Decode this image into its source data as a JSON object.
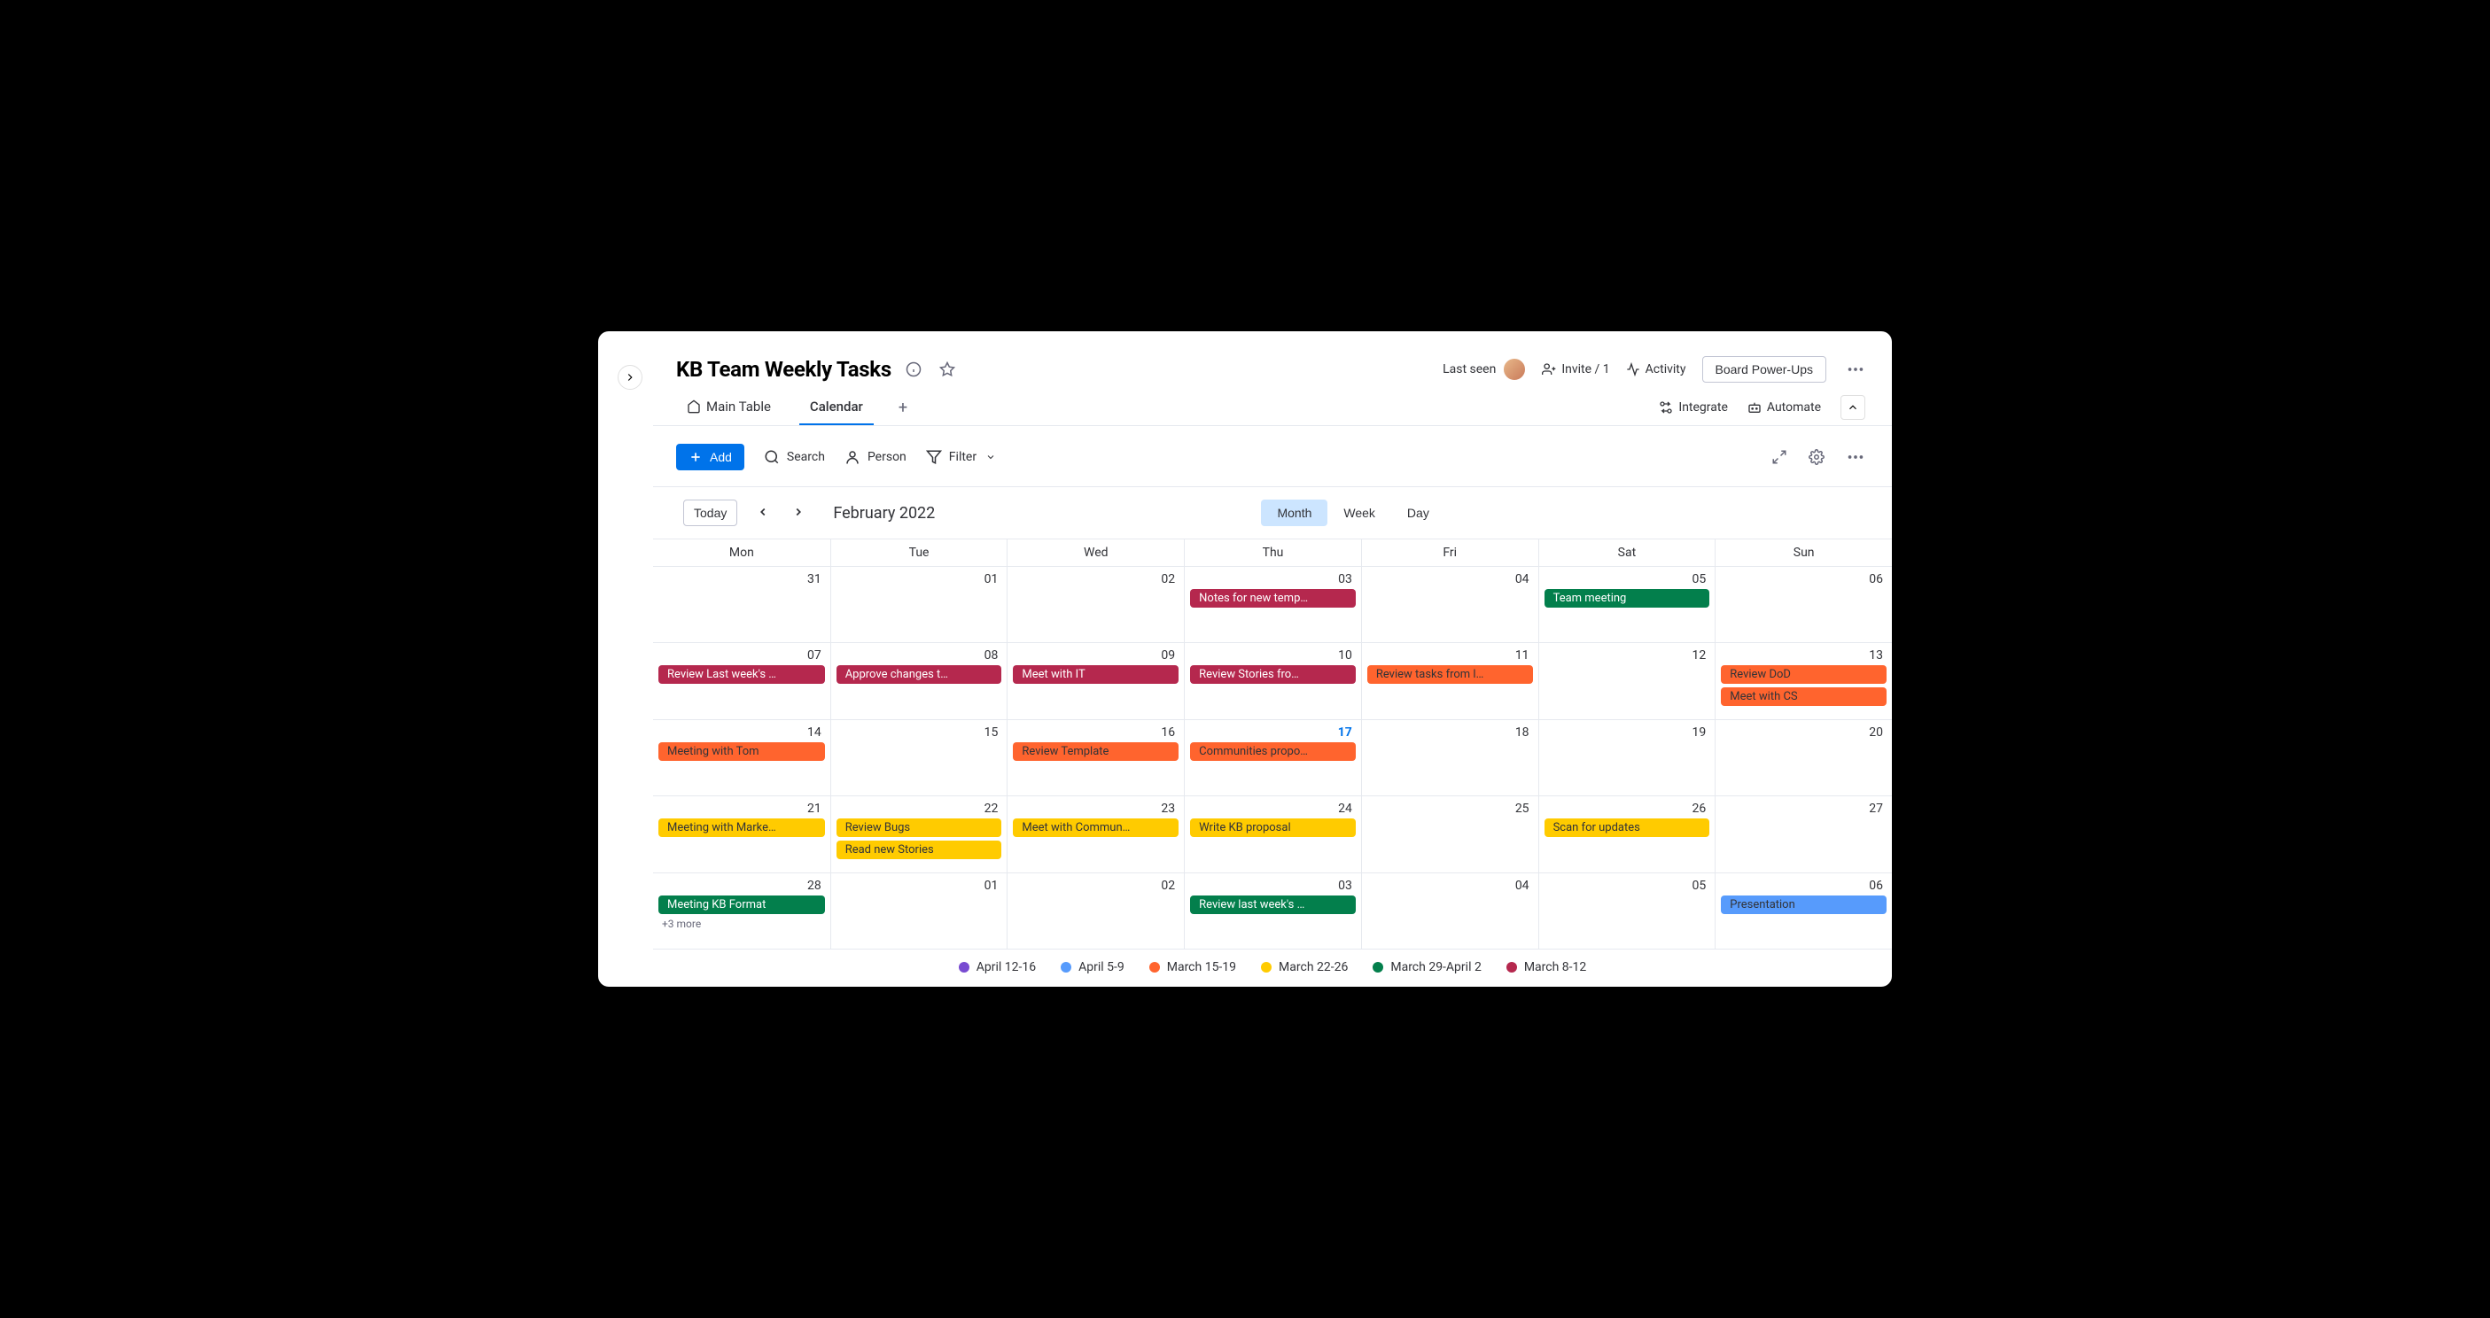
{
  "header": {
    "title": "KB Team Weekly Tasks",
    "last_seen": "Last seen",
    "invite": "Invite / 1",
    "activity": "Activity",
    "power_ups": "Board Power-Ups"
  },
  "tabs": {
    "main_table": "Main Table",
    "calendar": "Calendar",
    "integrate": "Integrate",
    "automate": "Automate"
  },
  "toolbar": {
    "add": "Add",
    "search": "Search",
    "person": "Person",
    "filter": "Filter"
  },
  "calendar_nav": {
    "today": "Today",
    "label": "February 2022",
    "month": "Month",
    "week": "Week",
    "day": "Day"
  },
  "dow": [
    "Mon",
    "Tue",
    "Wed",
    "Thu",
    "Fri",
    "Sat",
    "Sun"
  ],
  "weeks": [
    {
      "days": [
        {
          "num": "31",
          "events": []
        },
        {
          "num": "01",
          "events": []
        },
        {
          "num": "02",
          "events": []
        },
        {
          "num": "03",
          "events": [
            {
              "label": "Notes for new temp…",
              "color": "#b5284e",
              "text": "#fff"
            }
          ]
        },
        {
          "num": "04",
          "events": []
        },
        {
          "num": "05",
          "events": [
            {
              "label": "Team meeting",
              "color": "#037f4c",
              "text": "#fff"
            }
          ]
        },
        {
          "num": "06",
          "events": []
        }
      ]
    },
    {
      "days": [
        {
          "num": "07",
          "events": [
            {
              "label": "Review Last week's …",
              "color": "#b5284e",
              "text": "#fff"
            }
          ]
        },
        {
          "num": "08",
          "events": [
            {
              "label": "Approve changes t…",
              "color": "#b5284e",
              "text": "#fff"
            }
          ]
        },
        {
          "num": "09",
          "events": [
            {
              "label": "Meet with IT",
              "color": "#b5284e",
              "text": "#fff"
            }
          ]
        },
        {
          "num": "10",
          "events": [
            {
              "label": "Review Stories fro…",
              "color": "#b5284e",
              "text": "#fff"
            }
          ]
        },
        {
          "num": "11",
          "events": [
            {
              "label": "Review tasks from l…",
              "color": "#ff642e"
            }
          ]
        },
        {
          "num": "12",
          "events": []
        },
        {
          "num": "13",
          "events": [
            {
              "label": "Review DoD",
              "color": "#ff642e"
            },
            {
              "label": "Meet with CS",
              "color": "#ff642e"
            }
          ]
        }
      ]
    },
    {
      "days": [
        {
          "num": "14",
          "events": [
            {
              "label": "Meeting with Tom",
              "color": "#ff642e"
            }
          ]
        },
        {
          "num": "15",
          "events": []
        },
        {
          "num": "16",
          "events": [
            {
              "label": "Review Template",
              "color": "#ff642e"
            }
          ]
        },
        {
          "num": "17",
          "today": true,
          "events": [
            {
              "label": "Communities propo…",
              "color": "#ff642e"
            }
          ]
        },
        {
          "num": "18",
          "events": []
        },
        {
          "num": "19",
          "events": []
        },
        {
          "num": "20",
          "events": []
        }
      ]
    },
    {
      "days": [
        {
          "num": "21",
          "events": [
            {
              "label": "Meeting with Marke…",
              "color": "#ffcb00"
            }
          ]
        },
        {
          "num": "22",
          "events": [
            {
              "label": "Review Bugs",
              "color": "#ffcb00"
            },
            {
              "label": "Read new Stories",
              "color": "#ffcb00"
            }
          ]
        },
        {
          "num": "23",
          "events": [
            {
              "label": "Meet with Commun…",
              "color": "#ffcb00"
            }
          ]
        },
        {
          "num": "24",
          "events": [
            {
              "label": "Write KB proposal",
              "color": "#ffcb00"
            }
          ]
        },
        {
          "num": "25",
          "events": []
        },
        {
          "num": "26",
          "events": [
            {
              "label": "Scan for updates",
              "color": "#ffcb00"
            }
          ]
        },
        {
          "num": "27",
          "events": []
        }
      ]
    },
    {
      "days": [
        {
          "num": "28",
          "events": [
            {
              "label": "Meeting KB Format",
              "color": "#037f4c",
              "text": "#fff"
            }
          ],
          "more": "+3 more"
        },
        {
          "num": "01",
          "events": []
        },
        {
          "num": "02",
          "events": []
        },
        {
          "num": "03",
          "events": [
            {
              "label": "Review last week's …",
              "color": "#037f4c",
              "text": "#fff"
            }
          ]
        },
        {
          "num": "04",
          "events": []
        },
        {
          "num": "05",
          "events": []
        },
        {
          "num": "06",
          "events": [
            {
              "label": "Presentation",
              "color": "#579bfc"
            }
          ]
        }
      ]
    }
  ],
  "legend": [
    {
      "label": "April 12-16",
      "color": "#784bd1"
    },
    {
      "label": "April 5-9",
      "color": "#579bfc"
    },
    {
      "label": "March 15-19",
      "color": "#ff642e"
    },
    {
      "label": "March 22-26",
      "color": "#ffcb00"
    },
    {
      "label": "March 29-April 2",
      "color": "#037f4c"
    },
    {
      "label": "March 8-12",
      "color": "#b5284e"
    }
  ]
}
